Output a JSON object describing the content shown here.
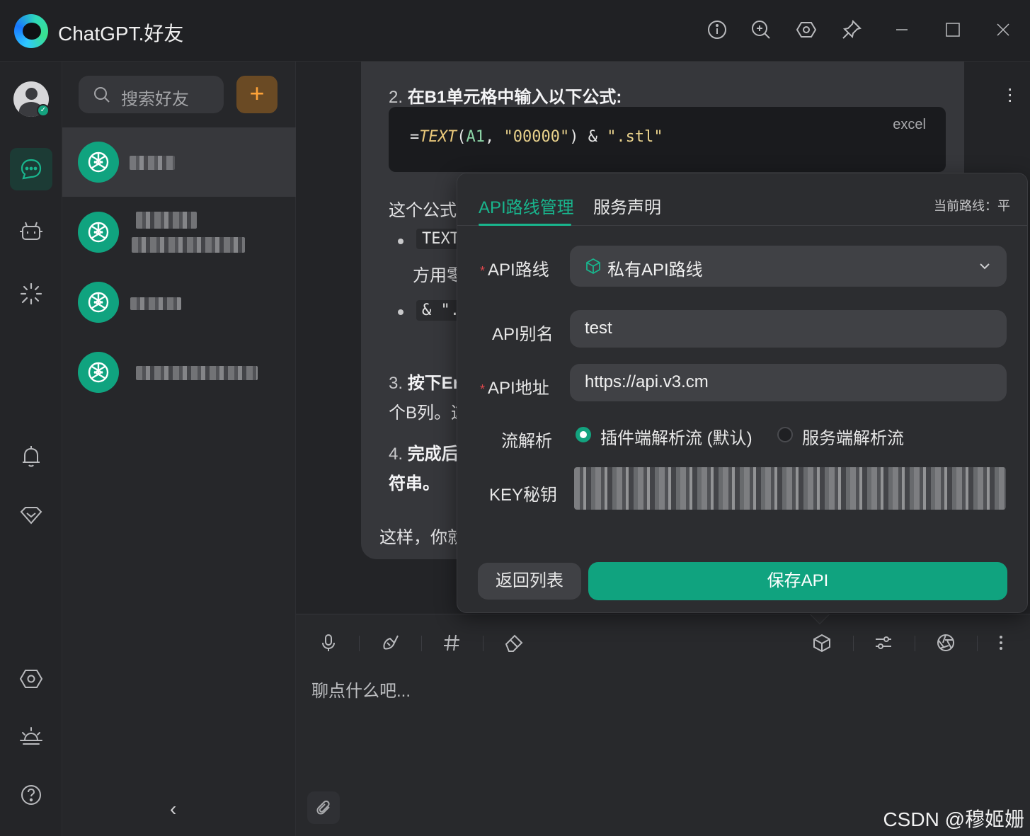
{
  "app": {
    "title": "ChatGPT.好友"
  },
  "contacts": {
    "search_placeholder": "搜索好友",
    "add_label": "+",
    "collapse_label": "‹"
  },
  "chat": {
    "step2_num": "2.",
    "step2_text": "在B1单元格中输入以下公式",
    "step2_colon": ":",
    "code_lang": "excel",
    "code_eq": "=",
    "code_fn": "TEXT",
    "code_open": "(",
    "code_arg": "A1",
    "code_comma": ", ",
    "code_str1": "\"00000\"",
    "code_close": ") & ",
    "code_str2": "\".stl\"",
    "para_prefix": "这个公式",
    "bullet1_code": "TEXT",
    "bullet1_cont": "方用零",
    "bullet2_code": "& \".",
    "step3_num": "3.",
    "step3_text": "按下Er",
    "step3_cont": "个B列。这",
    "step4_num": "4.",
    "step4_text": "完成后",
    "step4_cont": "符串。",
    "closing": "这样，你就"
  },
  "composer": {
    "placeholder": "聊点什么吧...",
    "watermark": "CSDN @穆姬姗"
  },
  "popover": {
    "tabs": [
      {
        "label": "API路线管理",
        "active": true
      },
      {
        "label": "服务声明",
        "active": false
      }
    ],
    "current_route": "当前路线：平",
    "fields": {
      "route_label": "API路线",
      "route_value": "私有API路线",
      "alias_label": "API别名",
      "alias_value": "test",
      "address_label": "API地址",
      "address_value": "https://api.v3.cm",
      "stream_label": "流解析",
      "stream_options": [
        {
          "label": "插件端解析流 (默认)",
          "selected": true
        },
        {
          "label": "服务端解析流",
          "selected": false
        }
      ],
      "key_label": "KEY秘钥"
    },
    "back_label": "返回列表",
    "save_label": "保存API"
  },
  "colors": {
    "accent": "#10a37f",
    "accent_text": "#19b58d",
    "add_button": "#ffa338",
    "required": "#e0474c"
  },
  "icons": {
    "titlebar": [
      "info-icon",
      "zoom-in-icon",
      "settings-hex-icon",
      "pin-icon",
      "minimize-icon",
      "maximize-icon",
      "close-icon"
    ],
    "rail": [
      "chat-icon",
      "robot-icon",
      "sparkle-icon",
      "bell-icon",
      "inbox-icon",
      "settings-hex-icon",
      "sunrise-icon",
      "help-icon"
    ],
    "composer": [
      "microphone-icon",
      "eraser-brush-icon",
      "hashtag-icon",
      "eraser-icon",
      "cube-icon",
      "sliders-icon",
      "aperture-icon",
      "more-vertical-icon",
      "paperclip-icon"
    ]
  }
}
